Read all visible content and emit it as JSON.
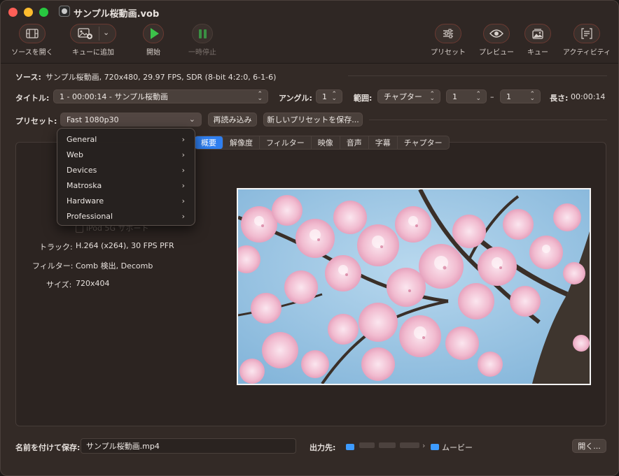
{
  "window": {
    "title": "サンプル桜動画.vob"
  },
  "toolbar": {
    "open_source": "ソースを開く",
    "add_queue": "キューに追加",
    "start": "開始",
    "pause": "一時停止",
    "presets": "プリセット",
    "preview": "プレビュー",
    "queue": "キュー",
    "activity": "アクティビティ"
  },
  "source": {
    "label": "ソース:",
    "value": "サンプル桜動画, 720x480, 29.97 FPS, SDR (8-bit 4:2:0, 6-1-6)"
  },
  "title_row": {
    "title_label": "タイトル:",
    "title_value": "1 - 00:00:14 - サンプル桜動画",
    "angle_label": "アングル:",
    "angle_value": "1",
    "range_label": "範囲:",
    "range_type": "チャプター",
    "range_start": "1",
    "range_dash": "–",
    "range_end": "1",
    "duration_label": "長さ:",
    "duration_value": "00:00:14"
  },
  "preset_row": {
    "label": "プリセット:",
    "value": "Fast 1080p30",
    "reload_button": "再読み込み",
    "save_button": "新しいプリセットを保存..."
  },
  "tabs": [
    "概要",
    "解像度",
    "フィルター",
    "映像",
    "音声",
    "字幕",
    "チャプター"
  ],
  "preset_menu": {
    "items": [
      "General",
      "Web",
      "Devices",
      "Matroska",
      "Hardware",
      "Professional"
    ]
  },
  "summary": {
    "ipod_partial": "iPod 5G サポート",
    "track_label": "トラック:",
    "track_value": "H.264 (x264), 30 FPS PFR",
    "filter_label": "フィルター:",
    "filter_value": "Comb 検出, Decomb",
    "size_label": "サイズ:",
    "size_value": "720x404"
  },
  "bottom": {
    "save_as_label": "名前を付けて保存:",
    "save_as_value": "サンプル桜動画.mp4",
    "destination_label": "出力先:",
    "destination_folder": "ムービー",
    "browse_button": "開く..."
  },
  "colors": {
    "accent": "#2f7ff0",
    "start_green": "#3cc24a",
    "background": "#332a26"
  }
}
